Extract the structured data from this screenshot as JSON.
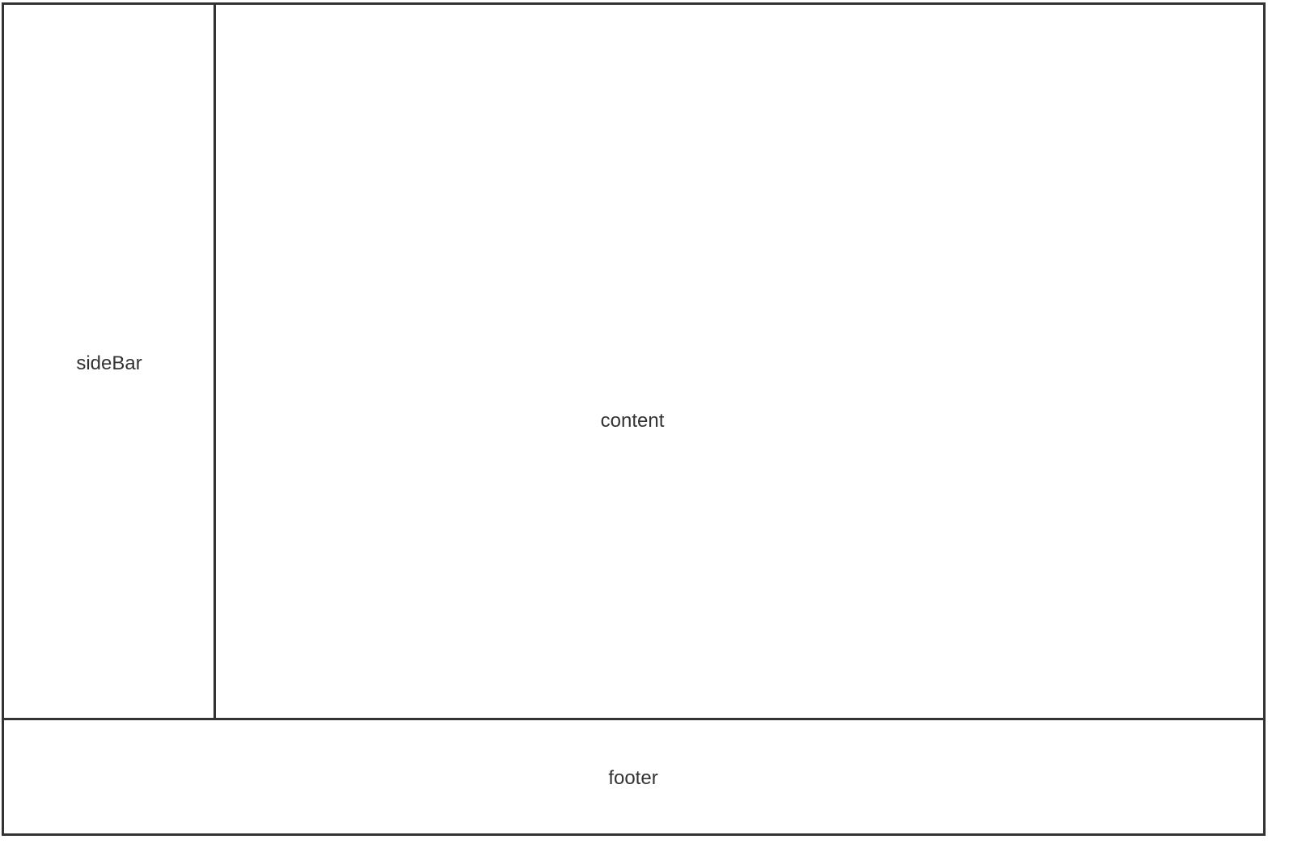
{
  "layout_regions": {
    "sidebar": {
      "label": "sideBar"
    },
    "content": {
      "label": "content"
    },
    "footer": {
      "label": "footer"
    }
  },
  "colors": {
    "border": "#333333",
    "text": "#333333",
    "background": "#ffffff"
  }
}
